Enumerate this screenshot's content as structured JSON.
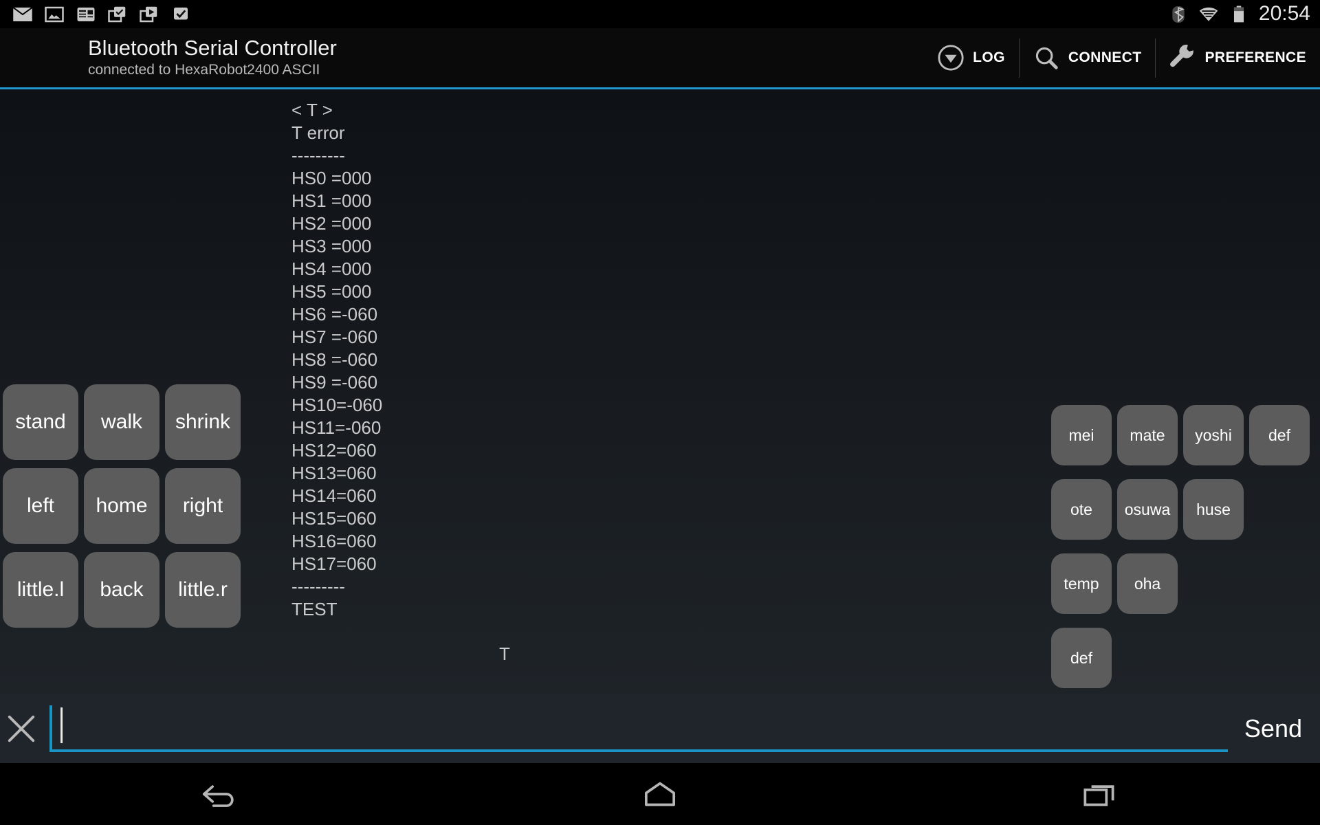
{
  "statusbar": {
    "clock": "20:54",
    "left_icons": [
      "mail-icon",
      "image-icon",
      "news-icon",
      "download-check-icon",
      "download-play-icon",
      "download-complete-icon"
    ],
    "right_icons": [
      "bluetooth-icon",
      "wifi-icon",
      "battery-icon"
    ]
  },
  "actionbar": {
    "title": "Bluetooth Serial Controller",
    "subtitle": "connected to HexaRobot2400  ASCII",
    "actions": [
      {
        "label": "LOG",
        "icon": "circle-down-arrow-icon"
      },
      {
        "label": "CONNECT",
        "icon": "search-icon"
      },
      {
        "label": "PREFERENCE",
        "icon": "wrench-icon"
      }
    ]
  },
  "terminal": {
    "lines": "< T >\nT error\n---------\nHS0 =000\nHS1 =000\nHS2 =000\nHS3 =000\nHS4 =000\nHS5 =000\nHS6 =-060\nHS7 =-060\nHS8 =-060\nHS9 =-060\nHS10=-060\nHS11=-060\nHS12=060\nHS13=060\nHS14=060\nHS15=060\nHS16=060\nHS17=060\n---------\nTEST",
    "echo": "T"
  },
  "left_pad": {
    "rows": [
      [
        "stand",
        "walk",
        "shrink"
      ],
      [
        "left",
        "home",
        "right"
      ],
      [
        "little.l",
        "back",
        "little.r"
      ]
    ]
  },
  "right_pad": {
    "rows": [
      [
        "mei",
        "mate",
        "yoshi",
        "def"
      ],
      [
        "ote",
        "osuwa",
        "huse"
      ],
      [
        "temp",
        "oha"
      ],
      [
        "def"
      ]
    ]
  },
  "input": {
    "clear_icon": "close-icon",
    "value": "",
    "placeholder": "",
    "send_label": "Send"
  },
  "navbar": {
    "items": [
      "back-icon",
      "home-icon",
      "recents-icon"
    ]
  },
  "colors": {
    "accent": "#1a94c4",
    "button": "#5c5c5c",
    "terminal_text": "#c9cbcc",
    "actionbar_bg": "#0a0a0a"
  }
}
